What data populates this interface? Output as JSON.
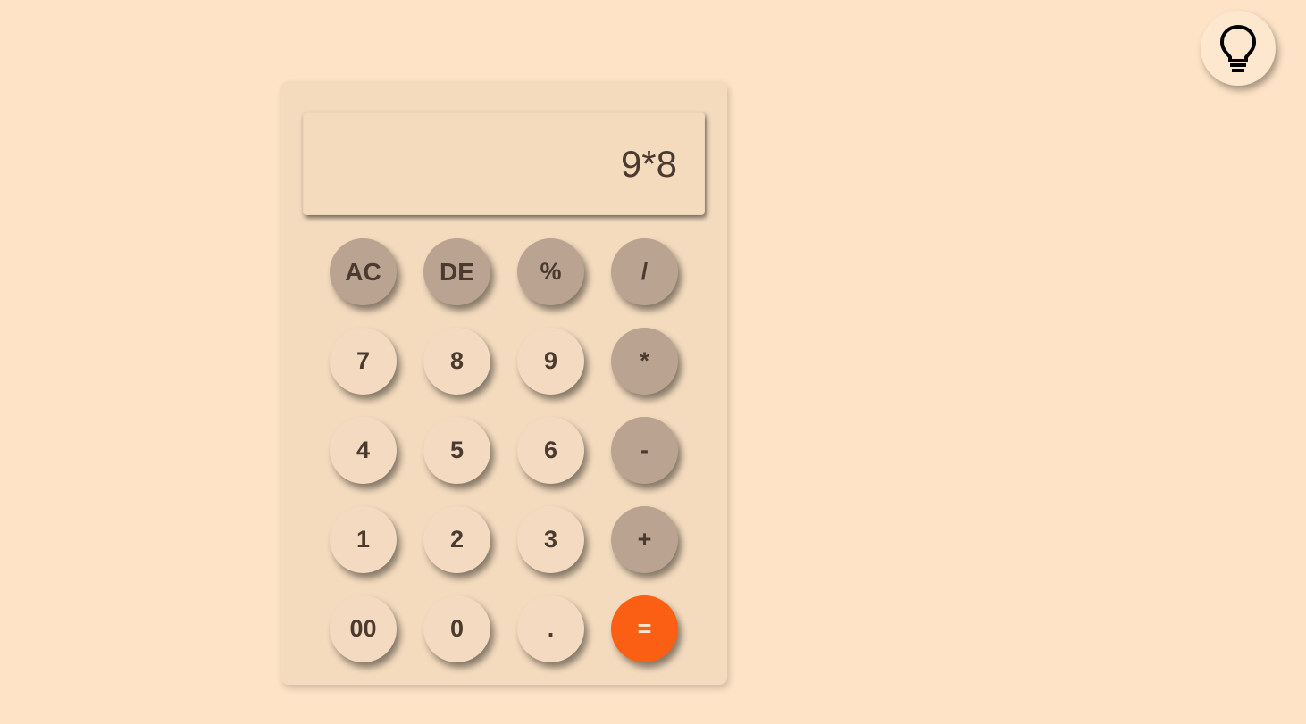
{
  "display": {
    "expression": "9*8"
  },
  "theme_toggle": {
    "icon": "lightbulb-icon"
  },
  "keys": [
    {
      "label": "AC",
      "kind": "fn",
      "name": "clear-all-button"
    },
    {
      "label": "DE",
      "kind": "fn",
      "name": "delete-button"
    },
    {
      "label": "%",
      "kind": "op",
      "name": "percent-button"
    },
    {
      "label": "/",
      "kind": "op",
      "name": "divide-button"
    },
    {
      "label": "7",
      "kind": "num",
      "name": "digit-7-button"
    },
    {
      "label": "8",
      "kind": "num",
      "name": "digit-8-button"
    },
    {
      "label": "9",
      "kind": "num",
      "name": "digit-9-button"
    },
    {
      "label": "*",
      "kind": "op",
      "name": "multiply-button"
    },
    {
      "label": "4",
      "kind": "num",
      "name": "digit-4-button"
    },
    {
      "label": "5",
      "kind": "num",
      "name": "digit-5-button"
    },
    {
      "label": "6",
      "kind": "num",
      "name": "digit-6-button"
    },
    {
      "label": "-",
      "kind": "op",
      "name": "subtract-button"
    },
    {
      "label": "1",
      "kind": "num",
      "name": "digit-1-button"
    },
    {
      "label": "2",
      "kind": "num",
      "name": "digit-2-button"
    },
    {
      "label": "3",
      "kind": "num",
      "name": "digit-3-button"
    },
    {
      "label": "+",
      "kind": "op",
      "name": "add-button"
    },
    {
      "label": "00",
      "kind": "num",
      "name": "double-zero-button"
    },
    {
      "label": "0",
      "kind": "num",
      "name": "digit-0-button"
    },
    {
      "label": ".",
      "kind": "num",
      "name": "decimal-point-button"
    },
    {
      "label": "=",
      "kind": "eq",
      "name": "equals-button"
    }
  ],
  "colors": {
    "background": "#fee3c6",
    "panel": "#f4dbbe",
    "operator_key": "#bba392",
    "equals_key": "#fa5f13",
    "text": "#4a3a30"
  }
}
